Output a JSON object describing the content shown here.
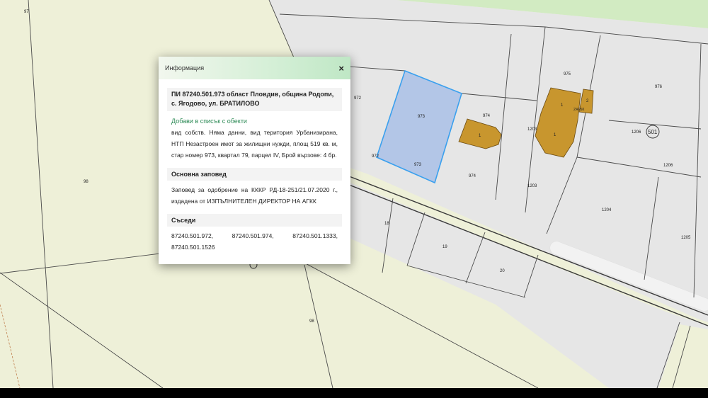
{
  "map": {
    "colors": {
      "field": "#eef0d8",
      "urban": "#e6e6e6",
      "boundary": "#4a4a4a",
      "building": "#c8962e",
      "selected_fill": "#b3c6e7",
      "selected_stroke": "#3aa0ee",
      "road_strip": "#ffffff",
      "green_top": "#d2ebc2"
    },
    "parcel_labels": {
      "p97": "97",
      "p98a": "98",
      "p98b": "98",
      "p972": "972",
      "p973": "973",
      "p973b": "973",
      "p972b": "972",
      "p974": "974",
      "p974b": "974",
      "p975": "975",
      "p976": "976",
      "p1203": "1203",
      "p1203b": "1203",
      "p1204": "1204",
      "p1205": "1205",
      "p1206": "1206",
      "p1206b": "1206",
      "p18": "18",
      "p19": "19",
      "p20": "20",
      "b1a": "1",
      "b1b": "1",
      "b1c": "1",
      "b2": "2",
      "b2kk": "2Ж-БК",
      "q501": "501"
    }
  },
  "panel": {
    "title": "Информация",
    "close_label": "×",
    "heading": "ПИ 87240.501.973 област Пловдив, община Родопи, с. Ягодово, ул. БРАТИЛОВО",
    "add_link": "Добави в списък с обекти",
    "description": "вид собств. Няма данни, вид територия Урбанизирана, НТП Незастроен имот за жилищни нужди, площ 519 кв. м, стар номер 973, квартал 79, парцел IV, Брой вързове: 4 бр.",
    "order_title": "Основна заповед",
    "order_text": "Заповед за одобрение на КККР РД-18-251/21.07.2020 г., издадена от ИЗПЪЛНИТЕЛЕН ДИРЕКТОР НА АГКК",
    "neighbors_title": "Съседи",
    "neighbors": [
      "87240.501.972,",
      "87240.501.974,",
      "87240.501.1333,",
      "87240.501.1526"
    ]
  }
}
